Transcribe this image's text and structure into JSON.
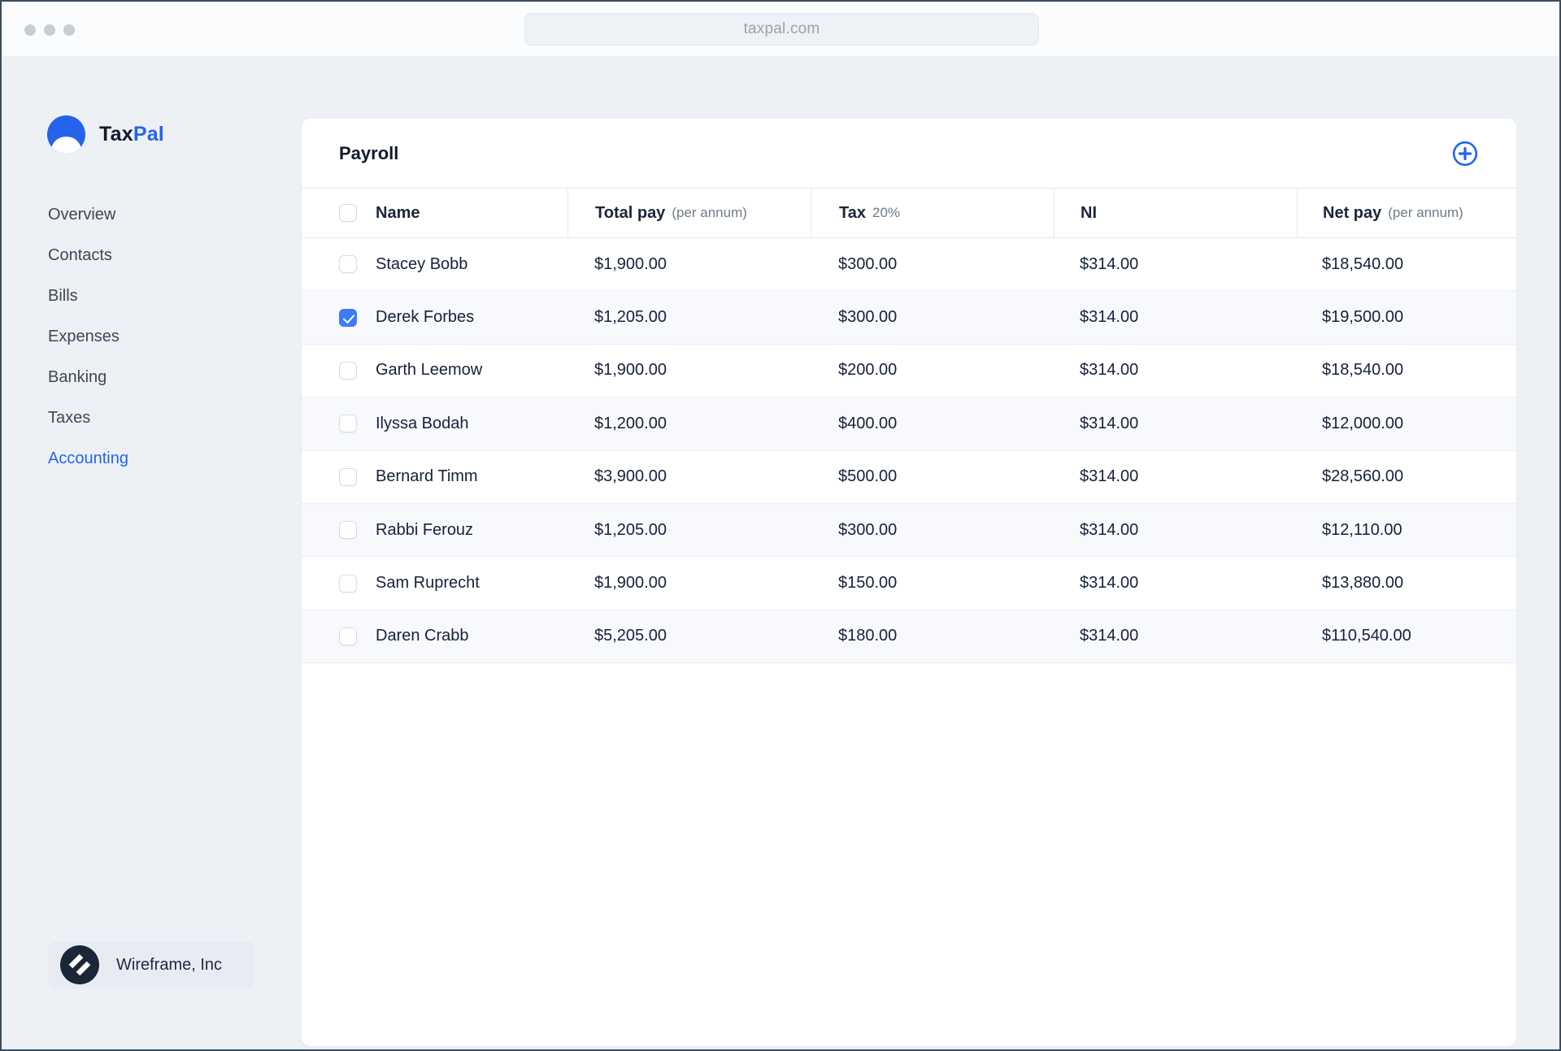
{
  "browser": {
    "url": "taxpal.com"
  },
  "brand": {
    "primary": "Tax",
    "secondary": "Pal"
  },
  "sidebar": {
    "items": [
      {
        "label": "Overview",
        "active": false
      },
      {
        "label": "Contacts",
        "active": false
      },
      {
        "label": "Bills",
        "active": false
      },
      {
        "label": "Expenses",
        "active": false
      },
      {
        "label": "Banking",
        "active": false
      },
      {
        "label": "Taxes",
        "active": false
      },
      {
        "label": "Accounting",
        "active": true
      }
    ]
  },
  "footer": {
    "company": "Wireframe, Inc"
  },
  "payroll": {
    "title": "Payroll",
    "columns": [
      {
        "label": "Name",
        "sub": ""
      },
      {
        "label": "Total pay",
        "sub": "(per annum)"
      },
      {
        "label": "Tax",
        "sub": "20%"
      },
      {
        "label": "NI",
        "sub": ""
      },
      {
        "label": "Net pay",
        "sub": "(per annum)"
      }
    ],
    "rows": [
      {
        "name": "Stacey Bobb",
        "total_pay": "$1,900.00",
        "tax": "$300.00",
        "ni": "$314.00",
        "net_pay": "$18,540.00",
        "checked": false
      },
      {
        "name": "Derek Forbes",
        "total_pay": "$1,205.00",
        "tax": "$300.00",
        "ni": "$314.00",
        "net_pay": "$19,500.00",
        "checked": true
      },
      {
        "name": "Garth Leemow",
        "total_pay": "$1,900.00",
        "tax": "$200.00",
        "ni": "$314.00",
        "net_pay": "$18,540.00",
        "checked": false
      },
      {
        "name": "Ilyssa Bodah",
        "total_pay": "$1,200.00",
        "tax": "$400.00",
        "ni": "$314.00",
        "net_pay": "$12,000.00",
        "checked": false
      },
      {
        "name": "Bernard Timm",
        "total_pay": "$3,900.00",
        "tax": "$500.00",
        "ni": "$314.00",
        "net_pay": "$28,560.00",
        "checked": false
      },
      {
        "name": "Rabbi Ferouz",
        "total_pay": "$1,205.00",
        "tax": "$300.00",
        "ni": "$314.00",
        "net_pay": "$12,110.00",
        "checked": false
      },
      {
        "name": "Sam Ruprecht",
        "total_pay": "$1,900.00",
        "tax": "$150.00",
        "ni": "$314.00",
        "net_pay": "$13,880.00",
        "checked": false
      },
      {
        "name": "Daren Crabb",
        "total_pay": "$5,205.00",
        "tax": "$180.00",
        "ni": "$314.00",
        "net_pay": "$110,540.00",
        "checked": false
      }
    ]
  },
  "colors": {
    "accent_blue": "#2563eb",
    "checkbox_checked": "#3e79f7",
    "dark_text": "#16213a",
    "page_bg": "#edf1f6"
  },
  "icons": {
    "window_controls": "three-gray-dots",
    "add": "circle-plus",
    "taxpal_logo": "blue-circle-white-smile",
    "wireframe_logo": "dark-circle-double-slash"
  }
}
